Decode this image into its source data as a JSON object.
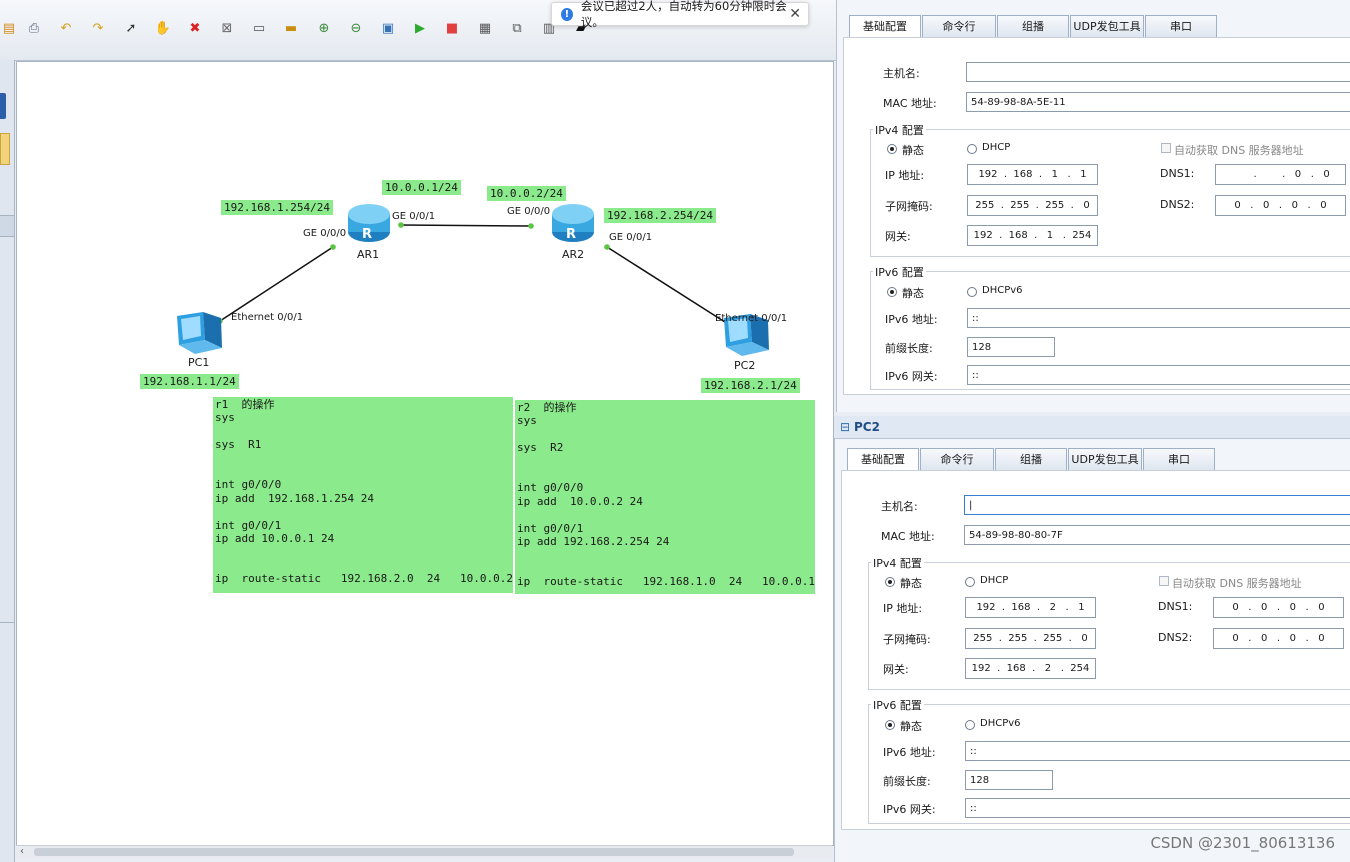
{
  "toast": {
    "message": "会议已超过2人，自动转为60分钟限时会议。",
    "close": "✕"
  },
  "toolbar": {
    "icons": [
      "save-icon",
      "print-icon",
      "undo-icon",
      "redo-icon",
      "pointer-icon",
      "hand-icon",
      "delete-icon",
      "delete-link-icon",
      "text-icon",
      "rectangle-icon",
      "zoom-in-icon",
      "zoom-out-icon",
      "fit-icon",
      "start-icon",
      "stop-icon",
      "capture-icon",
      "topology-icon",
      "grid-icon",
      "screenshot-icon"
    ]
  },
  "topology": {
    "links_labels": {
      "ar1_ge000_ip": "192.168.1.254/24",
      "ar1_ge001_ip": "10.0.0.1/24",
      "ar2_ge000_ip": "10.0.0.2/24",
      "ar2_ge001_ip": "192.168.2.254/24",
      "pc1_ip": "192.168.1.1/24",
      "pc2_ip": "192.168.2.1/24"
    },
    "ports": {
      "ar1_ge000": "GE 0/0/0",
      "ar1_ge001": "GE 0/0/1",
      "ar2_ge000": "GE 0/0/0",
      "ar2_ge001": "GE 0/0/1",
      "pc1_eth": "Ethernet 0/0/1",
      "pc2_eth": "Ethernet 0/0/1"
    },
    "devices": {
      "ar1": "AR1",
      "ar2": "AR2",
      "pc1": "PC1",
      "pc2": "PC2"
    },
    "notes": {
      "r1": "r1  的操作\nsys\n\nsys  R1\n\n\nint g0/0/0\nip add  192.168.1.254 24\n\nint g0/0/1\nip add 10.0.0.1 24\n\n\nip  route-static   192.168.2.0  24   10.0.0.2",
      "r2": "r2  的操作\nsys\n\nsys  R2\n\n\nint g0/0/0\nip add  10.0.0.2 24\n\nint g0/0/1\nip add 192.168.2.254 24\n\n\nip  route-static   192.168.1.0  24   10.0.0.1"
    }
  },
  "pc1_panel": {
    "tabs": [
      "基础配置",
      "命令行",
      "组播",
      "UDP发包工具",
      "串口"
    ],
    "hostname_label": "主机名:",
    "hostname_value": "",
    "mac_label": "MAC 地址:",
    "mac_value": "54-89-98-8A-5E-11",
    "ipv4_title": "IPv4 配置",
    "static_label": "静态",
    "dhcp_label": "DHCP",
    "auto_dns_label": "自动获取 DNS 服务器地址",
    "ip_label": "IP 地址:",
    "ip_value": "192  .  168  .   1   .   1",
    "mask_label": "子网掩码:",
    "mask_value": "255  .  255  .  255  .   0",
    "gw_label": "网关:",
    "gw_value": "192  .  168  .   1   .  254",
    "dns1_label": "DNS1:",
    "dns1_value": "       .        .   0   .   0",
    "dns2_label": "DNS2:",
    "dns2_value": "0   .   0   .   0   .   0",
    "ipv6_title": "IPv6 配置",
    "dhcpv6_label": "DHCPv6",
    "ipv6_addr_label": "IPv6 地址:",
    "ipv6_addr_value": "::",
    "prefix_label": "前缀长度:",
    "prefix_value": "128",
    "ipv6_gw_label": "IPv6 网关:",
    "ipv6_gw_value": "::"
  },
  "pc2_panel": {
    "title": "PC2",
    "tabs": [
      "基础配置",
      "命令行",
      "组播",
      "UDP发包工具",
      "串口"
    ],
    "hostname_label": "主机名:",
    "hostname_value": "|",
    "mac_label": "MAC 地址:",
    "mac_value": "54-89-98-80-80-7F",
    "ipv4_title": "IPv4 配置",
    "static_label": "静态",
    "dhcp_label": "DHCP",
    "auto_dns_label": "自动获取 DNS 服务器地址",
    "ip_label": "IP 地址:",
    "ip_value": "192  .  168  .   2   .   1",
    "mask_label": "子网掩码:",
    "mask_value": "255  .  255  .  255  .   0",
    "gw_label": "网关:",
    "gw_value": "192  .  168  .   2   .  254",
    "dns1_label": "DNS1:",
    "dns1_value": "0   .   0   .   0   .   0",
    "dns2_label": "DNS2:",
    "dns2_value": "0   .   0   .   0   .   0",
    "ipv6_title": "IPv6 配置",
    "dhcpv6_label": "DHCPv6",
    "ipv6_addr_label": "IPv6 地址:",
    "ipv6_addr_value": "::",
    "prefix_label": "前缀长度:",
    "prefix_value": "128",
    "ipv6_gw_label": "IPv6 网关:",
    "ipv6_gw_value": "::"
  },
  "watermark": "CSDN @2301_80613136",
  "colors": {
    "label_bg": "#8bea8b",
    "router": "#3aa8e0",
    "link_dot": "#5cc443"
  }
}
